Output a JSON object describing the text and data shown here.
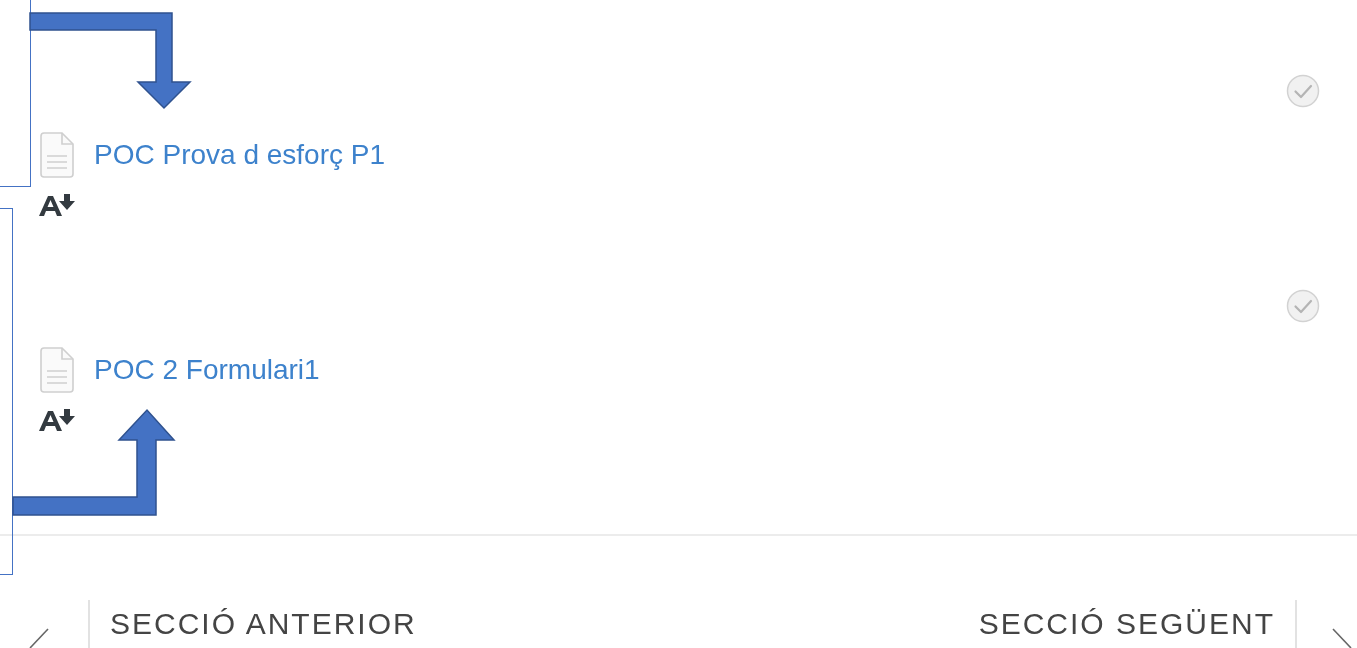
{
  "activities": [
    {
      "title": "POC Prova d esforç P1",
      "completed": false
    },
    {
      "title": "POC 2 Formulari1",
      "completed": false
    }
  ],
  "navigation": {
    "previous": "SECCIÓ ANTERIOR",
    "next": "SECCIÓ SEGÜENT"
  }
}
